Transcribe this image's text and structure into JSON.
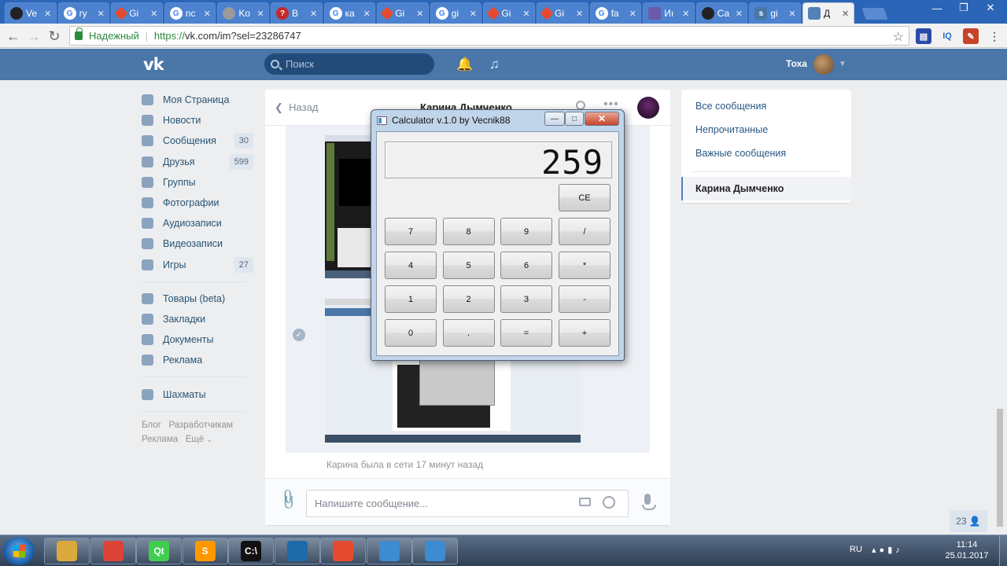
{
  "browser": {
    "tabs": [
      {
        "label": "Ve",
        "icon": "github-icon",
        "fav": "fav-github",
        "glyph": ""
      },
      {
        "label": "ry",
        "icon": "google-icon",
        "fav": "fav-google",
        "glyph": "G"
      },
      {
        "label": "Gi",
        "icon": "git-icon",
        "fav": "fav-git",
        "glyph": ""
      },
      {
        "label": "nc",
        "icon": "google-icon",
        "fav": "fav-google",
        "glyph": "G"
      },
      {
        "label": "Ko",
        "icon": "globe-icon",
        "fav": "fav-globe",
        "glyph": ""
      },
      {
        "label": "B",
        "icon": "question-icon",
        "fav": "fav-bold",
        "glyph": "?"
      },
      {
        "label": "ка",
        "icon": "google-icon",
        "fav": "fav-google",
        "glyph": "G"
      },
      {
        "label": "Gi",
        "icon": "git-icon",
        "fav": "fav-git",
        "glyph": ""
      },
      {
        "label": "gi",
        "icon": "google-icon",
        "fav": "fav-google",
        "glyph": "G"
      },
      {
        "label": "Gi",
        "icon": "git-icon",
        "fav": "fav-git",
        "glyph": ""
      },
      {
        "label": "Gi",
        "icon": "git-icon",
        "fav": "fav-git",
        "glyph": ""
      },
      {
        "label": "fa",
        "icon": "google-icon",
        "fav": "fav-google",
        "glyph": "G"
      },
      {
        "label": "Иı",
        "icon": "user-icon",
        "fav": "fav-user",
        "glyph": ""
      },
      {
        "label": "Ca",
        "icon": "github-icon",
        "fav": "fav-github",
        "glyph": ""
      },
      {
        "label": "gi",
        "icon": "doc-icon",
        "fav": "fav-vk",
        "glyph": "s"
      },
      {
        "label": "Д",
        "icon": "vk-chat-icon",
        "fav": "fav-chat",
        "glyph": "",
        "active": true
      }
    ],
    "secure_label": "Надежный",
    "url_protocol": "https://",
    "url_host": "vk.com/im?sel=23286747"
  },
  "vk": {
    "search_placeholder": "Поиск",
    "user_name": "Тоха",
    "menu": [
      {
        "label": "Моя Страница",
        "name": "my-page",
        "count": ""
      },
      {
        "label": "Новости",
        "name": "news",
        "count": ""
      },
      {
        "label": "Сообщения",
        "name": "messages",
        "count": "30"
      },
      {
        "label": "Друзья",
        "name": "friends",
        "count": "599"
      },
      {
        "label": "Группы",
        "name": "groups",
        "count": ""
      },
      {
        "label": "Фотографии",
        "name": "photos",
        "count": ""
      },
      {
        "label": "Аудиозаписи",
        "name": "audio",
        "count": ""
      },
      {
        "label": "Видеозаписи",
        "name": "video",
        "count": ""
      },
      {
        "label": "Игры",
        "name": "games",
        "count": "27"
      }
    ],
    "menu2": [
      {
        "label": "Товары (beta)",
        "name": "goods"
      },
      {
        "label": "Закладки",
        "name": "bookmarks"
      },
      {
        "label": "Документы",
        "name": "documents"
      },
      {
        "label": "Реклама",
        "name": "ads"
      }
    ],
    "menu3": [
      {
        "label": "Шахматы",
        "name": "chess"
      }
    ],
    "footer": {
      "blog": "Блог",
      "dev": "Разработчикам",
      "ads": "Реклама",
      "more": "Ещё"
    },
    "chat": {
      "back_label": "Назад",
      "title": "Карина Дымченко",
      "online_status": "Карина была в сети 17 минут назад",
      "input_placeholder": "Напишите сообщение..."
    },
    "right_panel": {
      "all": "Все сообщения",
      "unread": "Непрочитанные",
      "important": "Важные сообщения",
      "active_chat": "Карина Дымченко"
    },
    "online_count": "23"
  },
  "calculator": {
    "title": "Calculator v.1.0 by Vecnik88",
    "display": "259",
    "clear_label": "CE",
    "buttons": [
      [
        "7",
        "8",
        "9",
        "/"
      ],
      [
        "4",
        "5",
        "6",
        "*"
      ],
      [
        "1",
        "2",
        "3",
        "-"
      ],
      [
        "0",
        ".",
        "=",
        "+"
      ]
    ]
  },
  "taskbar": {
    "apps": [
      {
        "name": "explorer",
        "icon": "folder-icon",
        "color": "#d9a93b",
        "glyph": ""
      },
      {
        "name": "chrome",
        "icon": "chrome-icon",
        "color": "#db4437",
        "glyph": ""
      },
      {
        "name": "qt-creator",
        "icon": "qt-icon",
        "color": "#41cd52",
        "glyph": "Qt"
      },
      {
        "name": "sublime",
        "icon": "sublime-icon",
        "color": "#ff9800",
        "glyph": "S"
      },
      {
        "name": "cmd",
        "icon": "terminal-icon",
        "color": "#111111",
        "glyph": "C:\\"
      },
      {
        "name": "sourcetree",
        "icon": "sourcetree-icon",
        "color": "#1d6aa8",
        "glyph": ""
      },
      {
        "name": "git-extensions",
        "icon": "git-extensions-icon",
        "color": "#e64a2e",
        "glyph": ""
      },
      {
        "name": "calculator-1",
        "icon": "window-icon",
        "color": "#3d8bd1",
        "glyph": ""
      },
      {
        "name": "calculator-2",
        "icon": "window-icon",
        "color": "#3d8bd1",
        "glyph": ""
      }
    ],
    "lang": "RU",
    "time": "11:14",
    "date": "25.01.2017"
  }
}
